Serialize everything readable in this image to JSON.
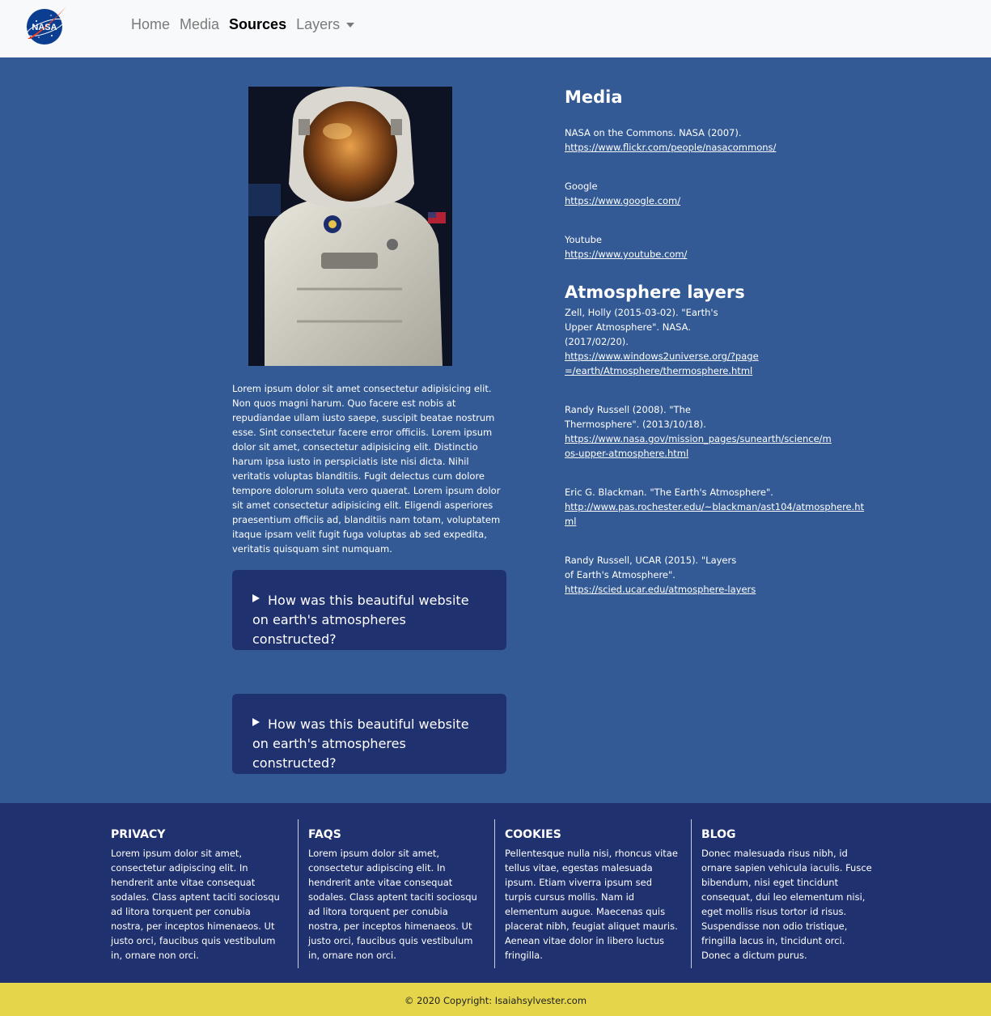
{
  "nav": {
    "logo_text": "NASA",
    "links": [
      {
        "label": "Home"
      },
      {
        "label": "Media"
      },
      {
        "label": "Sources"
      },
      {
        "label": "Layers"
      }
    ]
  },
  "main": {
    "lorem": "Lorem ipsum dolor sit amet consectetur adipisicing elit. Non quos magni harum. Quo facere est nobis at repudiandae ullam iusto saepe, suscipit beatae nostrum esse. Sint consectetur facere error officiis. Lorem ipsum dolor sit amet, consectetur adipisicing elit. Distinctio harum ipsa iusto in perspiciatis iste nisi dicta. Nihil veritatis voluptas blanditiis. Fugit delectus cum dolore tempore dolorum soluta vero quaerat. Lorem ipsum dolor sit amet consectetur adipisicing elit. Eligendi asperiores praesentium officiis ad, blanditiis nam totam, voluptatem itaque ipsam velit fugit fuga voluptas ab sed expedita, veritatis quisquam sint numquam.",
    "faqs": [
      {
        "question": "How was this beautiful website on earth's atmospheres constructed?"
      },
      {
        "question": "How was this beautiful website on earth's atmospheres constructed?"
      }
    ]
  },
  "sources": {
    "media_heading": "Media",
    "media": [
      {
        "text": "NASA on the Commons. NASA (2007).",
        "url": "https://www.flickr.com/people/nasacommons/"
      },
      {
        "text": "Google",
        "url": "https://www.google.com/"
      },
      {
        "text": "Youtube",
        "url": "https://www.youtube.com/"
      }
    ],
    "atmo_heading": "Atmosphere layers",
    "atmosphere": [
      {
        "text": "Zell, Holly (2015-03-02). \"Earth's Upper Atmosphere\". NASA. (2017/02/20).",
        "url": "https://www.windows2universe.org/?page=/earth/Atmosphere/thermosphere.html"
      },
      {
        "text": "Randy Russell (2008). \"The Thermosphere\". (2013/10/18).",
        "url": "https://www.nasa.gov/mission_pages/sunearth/science/mos-upper-atmosphere.html"
      },
      {
        "text": "Eric G. Blackman. \"The Earth's Atmosphere\".",
        "url": "http://www.pas.rochester.edu/~blackman/ast104/atmosphere.html"
      },
      {
        "text": "Randy Russell, UCAR (2015). \"Layers of Earth's Atmosphere\".",
        "url": "https://scied.ucar.edu/atmosphere-layers"
      }
    ]
  },
  "footer": {
    "columns": [
      {
        "title": "PRIVACY",
        "body": "Lorem ipsum dolor sit amet, consectetur adipiscing elit. In hendrerit ante vitae consequat sodales. Class aptent taciti sociosqu ad litora torquent per conubia nostra, per inceptos himenaeos. Ut justo orci, faucibus quis vestibulum in, ornare non orci."
      },
      {
        "title": "FAQS",
        "body": "Lorem ipsum dolor sit amet, consectetur adipiscing elit. In hendrerit ante vitae consequat sodales. Class aptent taciti sociosqu ad litora torquent per conubia nostra, per inceptos himenaeos. Ut justo orci, faucibus quis vestibulum in, ornare non orci."
      },
      {
        "title": "COOKIES",
        "body": "Pellentesque nulla nisi, rhoncus vitae tellus vitae, egestas malesuada ipsum. Etiam viverra ipsum sed turpis cursus mollis. Nam id elementum augue. Maecenas quis placerat nibh, feugiat aliquet mauris. Aenean vitae dolor in libero luctus fringilla."
      },
      {
        "title": "BLOG",
        "body": "Donec malesuada risus nibh, id ornare sapien vehicula iaculis. Fusce bibendum, nisi eget tincidunt consequat, dui leo elementum nisi, eget mollis risus tortor id risus. Suspendisse non odio tristique, fringilla lacus in, tincidunt orci. Donec a dictum purus."
      }
    ],
    "copyright": "© 2020 Copyright: Isaiahsylvester.com"
  },
  "colors": {
    "navbar_bg": "#f8f9fa",
    "page_bg": "#335a95",
    "card_bg": "#20316f",
    "footer_bg": "#20316f",
    "copyright_bg": "#e4d54a"
  }
}
